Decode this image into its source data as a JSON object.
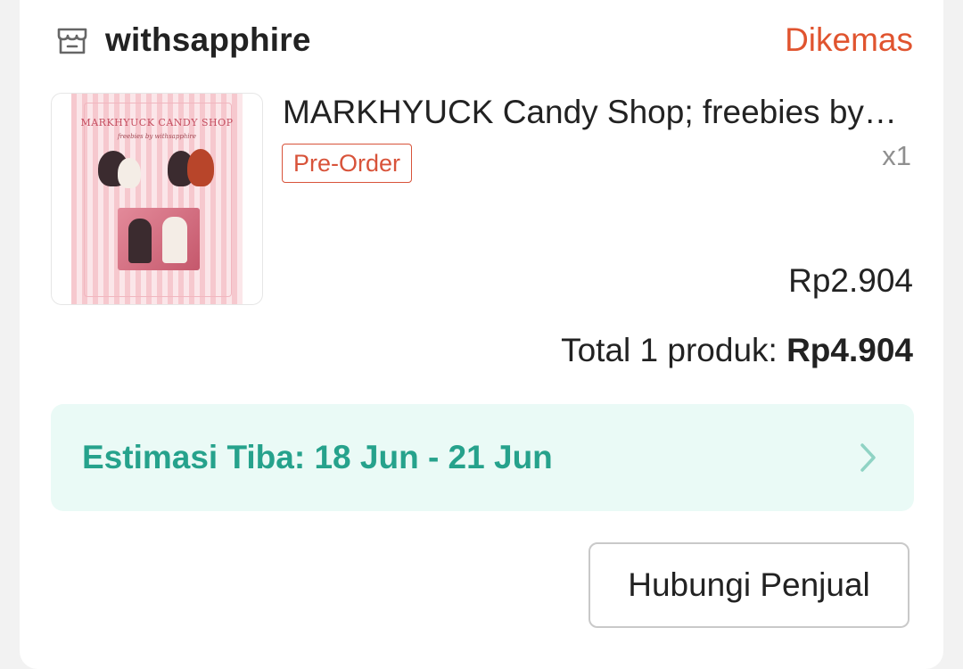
{
  "shop": {
    "icon": "store-icon",
    "name": "withsapphire",
    "status": "Dikemas"
  },
  "product": {
    "thumbnail_title": "MARKHYUCK CANDY SHOP",
    "thumbnail_subtitle": "freebies by withsapphire",
    "title": "MARKHYUCK Candy Shop; freebies by…",
    "badge": "Pre-Order",
    "quantity": "x1",
    "price": "Rp2.904"
  },
  "summary": {
    "total_label": "Total 1 produk: ",
    "total_amount": "Rp4.904"
  },
  "delivery": {
    "estimate": "Estimasi Tiba: 18 Jun - 21 Jun",
    "chevron_icon": "chevron-right-icon"
  },
  "actions": {
    "contact_label": "Hubungi Penjual"
  },
  "colors": {
    "status": "#e0542f",
    "estimate_text": "#26a28c",
    "estimate_bg": "#eafaf6"
  }
}
